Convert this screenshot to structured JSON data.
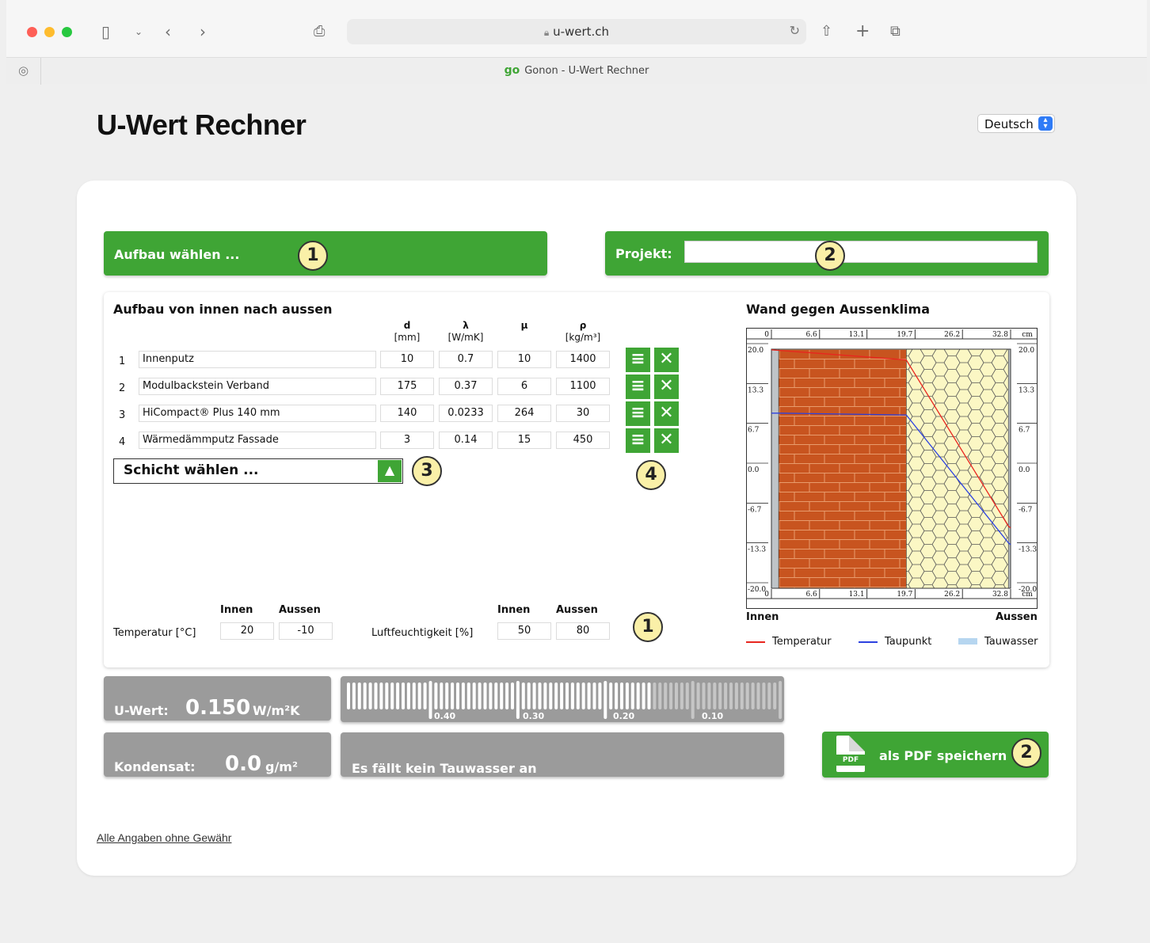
{
  "browser": {
    "url": "u-wert.ch",
    "tab_logo": "go",
    "tab_title": "Gonon - U-Wert Rechner"
  },
  "page": {
    "title": "U-Wert Rechner",
    "language": "Deutsch"
  },
  "top_bars": {
    "aufbau_label": "Aufbau wählen ...",
    "projekt_label": "Projekt:",
    "projekt_value": ""
  },
  "badges": {
    "one": "1",
    "two": "2",
    "three": "3",
    "four": "4"
  },
  "layers": {
    "title": "Aufbau von innen nach aussen",
    "headers": [
      {
        "sym": "d",
        "unit": "[mm]"
      },
      {
        "sym": "λ",
        "unit": "[W/mK]"
      },
      {
        "sym": "μ",
        "unit": ""
      },
      {
        "sym": "ρ",
        "unit": "[kg/m³]"
      }
    ],
    "rows": [
      {
        "num": "1",
        "name": "Innenputz",
        "d": "10",
        "lambda": "0.7",
        "mu": "10",
        "rho": "1400"
      },
      {
        "num": "2",
        "name": "Modulbackstein Verband",
        "d": "175",
        "lambda": "0.37",
        "mu": "6",
        "rho": "1100"
      },
      {
        "num": "3",
        "name": "HiCompact® Plus 140 mm",
        "d": "140",
        "lambda": "0.0233",
        "mu": "264",
        "rho": "30"
      },
      {
        "num": "4",
        "name": "Wärmedämmputz Fassade",
        "d": "3",
        "lambda": "0.14",
        "mu": "15",
        "rho": "450"
      }
    ],
    "select_placeholder": "Schicht wählen ..."
  },
  "climate": {
    "innen": "Innen",
    "aussen": "Aussen",
    "temp_label": "Temperatur [°C]",
    "temp_innen": "20",
    "temp_aussen": "-10",
    "hum_label": "Luftfeuchtigkeit [%]",
    "hum_innen": "50",
    "hum_aussen": "80"
  },
  "chart": {
    "title": "Wand gegen Aussenklima",
    "x_ticks": [
      "0",
      "6.6",
      "13.1",
      "19.7",
      "26.2",
      "32.8"
    ],
    "x_unit": "cm",
    "y_ticks": [
      "20.0",
      "13.3",
      "6.7",
      "0.0",
      "-6.7",
      "-13.3",
      "-20.0"
    ],
    "side_left": "Innen",
    "side_right": "Aussen",
    "legend": [
      "Temperatur",
      "Taupunkt",
      "Tauwasser"
    ]
  },
  "chart_data": {
    "type": "line",
    "title": "Wand gegen Aussenklima",
    "xlabel": "cm",
    "x_ticks": [
      0,
      6.6,
      13.1,
      19.7,
      26.2,
      32.8
    ],
    "xlim": [
      0,
      32.8
    ],
    "y_ticks": [
      20.0,
      13.3,
      6.7,
      0.0,
      -6.7,
      -13.3,
      -20.0
    ],
    "ylim": [
      -20,
      20
    ],
    "layers_cm": [
      {
        "name": "Innenputz",
        "from": 0,
        "to": 1.0
      },
      {
        "name": "Modulbackstein Verband",
        "from": 1.0,
        "to": 18.5
      },
      {
        "name": "HiCompact® Plus 140 mm",
        "from": 18.5,
        "to": 32.5
      },
      {
        "name": "Wärmedämmputz Fassade",
        "from": 32.5,
        "to": 32.8
      }
    ],
    "series": [
      {
        "name": "Temperatur",
        "color": "#e8261f",
        "x": [
          0,
          1.0,
          18.5,
          32.5,
          32.8
        ],
        "y": [
          19.9,
          19.8,
          18.2,
          -9.6,
          -9.9
        ]
      },
      {
        "name": "Taupunkt",
        "color": "#2c41e0",
        "x": [
          0,
          1.0,
          18.5,
          32.5,
          32.8
        ],
        "y": [
          9.3,
          9.3,
          9.0,
          -12.4,
          -12.7
        ]
      }
    ],
    "legend": [
      "Temperatur",
      "Taupunkt",
      "Tauwasser"
    ]
  },
  "results": {
    "uwert_label": "U-Wert:",
    "uwert_value": "0.150",
    "uwert_unit": "W/m²K",
    "uwert_fraction": 0.15,
    "scale_labels": [
      "0.40",
      "0.30",
      "0.20",
      "0.10"
    ],
    "kondensat_label": "Kondensat:",
    "kondensat_value": "0.0",
    "kondensat_unit": "g/m²",
    "message": "Es fällt kein Tauwasser an",
    "pdf_label": "als PDF speichern",
    "pdf_icon_text": "PDF"
  },
  "footer": {
    "disclaimer": "Alle Angaben ohne Gewähr"
  }
}
